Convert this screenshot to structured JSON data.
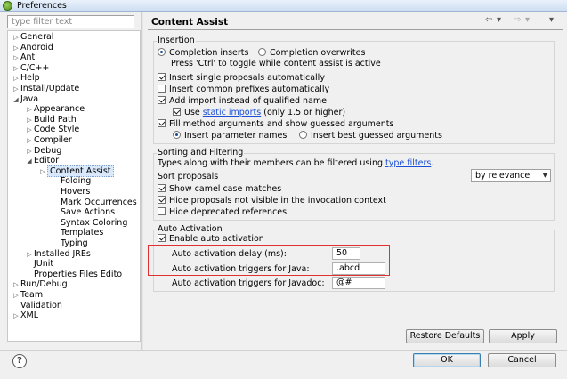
{
  "window": {
    "title": "Preferences"
  },
  "filter": {
    "placeholder": "type filter text"
  },
  "tree": [
    {
      "label": "General",
      "arrow": "▷"
    },
    {
      "label": "Android",
      "arrow": "▷"
    },
    {
      "label": "Ant",
      "arrow": "▷"
    },
    {
      "label": "C/C++",
      "arrow": "▷"
    },
    {
      "label": "Help",
      "arrow": "▷"
    },
    {
      "label": "Install/Update",
      "arrow": "▷"
    },
    {
      "label": "Java",
      "arrow": "◢"
    },
    {
      "label": "Appearance",
      "arrow": "▷"
    },
    {
      "label": "Build Path",
      "arrow": "▷"
    },
    {
      "label": "Code Style",
      "arrow": "▷"
    },
    {
      "label": "Compiler",
      "arrow": "▷"
    },
    {
      "label": "Debug",
      "arrow": "▷"
    },
    {
      "label": "Editor",
      "arrow": "◢"
    },
    {
      "label": "Content Assist",
      "arrow": "▷"
    },
    {
      "label": "Folding",
      "arrow": ""
    },
    {
      "label": "Hovers",
      "arrow": ""
    },
    {
      "label": "Mark Occurrences",
      "arrow": ""
    },
    {
      "label": "Save Actions",
      "arrow": ""
    },
    {
      "label": "Syntax Coloring",
      "arrow": ""
    },
    {
      "label": "Templates",
      "arrow": ""
    },
    {
      "label": "Typing",
      "arrow": ""
    },
    {
      "label": "Installed JREs",
      "arrow": "▷"
    },
    {
      "label": "JUnit",
      "arrow": ""
    },
    {
      "label": "Properties Files Edito",
      "arrow": ""
    },
    {
      "label": "Run/Debug",
      "arrow": "▷"
    },
    {
      "label": "Team",
      "arrow": "▷"
    },
    {
      "label": "Validation",
      "arrow": ""
    },
    {
      "label": "XML",
      "arrow": "▷"
    }
  ],
  "page": {
    "title": "Content Assist",
    "insertion": {
      "title": "Insertion",
      "completion_inserts": "Completion inserts",
      "completion_overwrites": "Completion overwrites",
      "toggle_hint": "Press 'Ctrl' to toggle while content assist is active",
      "insert_single": "Insert single proposals automatically",
      "insert_prefixes": "Insert common prefixes automatically",
      "add_import": "Add import instead of qualified name",
      "use_label": "Use",
      "static_imports": "static imports",
      "static_suffix": "(only 1.5 or higher)",
      "fill_args": "Fill method arguments and show guessed arguments",
      "insert_param_names": "Insert parameter names",
      "insert_best_guessed": "Insert best guessed arguments"
    },
    "sorting": {
      "title": "Sorting and Filtering",
      "types_text": "Types along with their members can be filtered using",
      "type_filters": "type filters",
      "type_filters_suffix": ".",
      "sort_proposals": "Sort proposals",
      "sort_value": "by relevance",
      "camel_case": "Show camel case matches",
      "hide_not_visible": "Hide proposals not visible in the invocation context",
      "hide_deprecated": "Hide deprecated references"
    },
    "auto": {
      "title": "Auto Activation",
      "enable": "Enable auto activation",
      "delay_label": "Auto activation delay (ms):",
      "delay_value": "50",
      "java_label": "Auto activation triggers for Java:",
      "java_value": ".abcd",
      "javadoc_label": "Auto activation triggers for Javadoc:",
      "javadoc_value": "@#"
    },
    "buttons": {
      "restore": "Restore Defaults",
      "apply": "Apply"
    }
  },
  "dialog": {
    "ok": "OK",
    "cancel": "Cancel",
    "help_glyph": "?"
  },
  "nav_icons": {
    "back": "⇦",
    "back_dd": "▾",
    "forward": "⇨",
    "forward_dd": "▾",
    "menu": "▾"
  }
}
